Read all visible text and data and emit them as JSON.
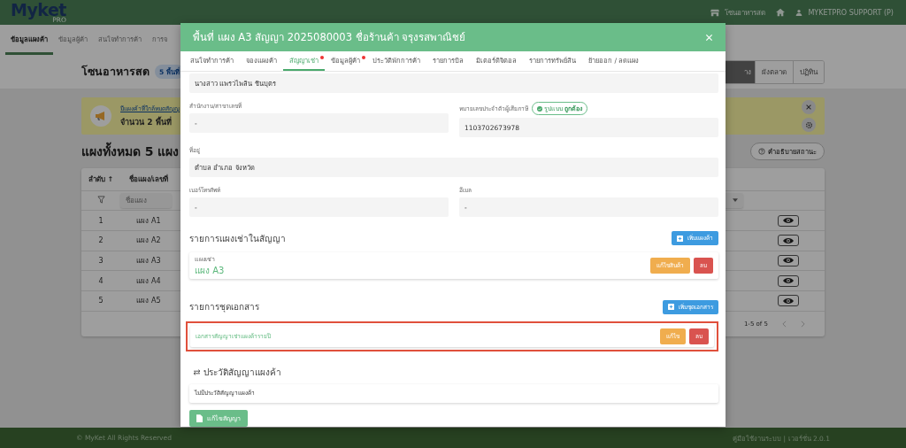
{
  "header": {
    "logo": "Myket",
    "logo_sub": "PRO",
    "zone": "โซนอาหารสด",
    "user": "MYKETPRO SUPPORT (P)"
  },
  "nav": [
    {
      "label": "ข้อมูลแผงค้า",
      "selected": true
    },
    {
      "label": "ข้อมูลผู้ค้า",
      "selected": false
    },
    {
      "label": "สนใจทำการค้า",
      "selected": false
    },
    {
      "label": "การจ",
      "selected": false
    }
  ],
  "page": {
    "title": "โซนอาหารสด",
    "badge": "5 พื้นที่",
    "views": [
      {
        "label": "าง",
        "selected": true
      },
      {
        "label": "ผังตลาด",
        "selected": false
      },
      {
        "label": "ปฏิทิน",
        "selected": false
      }
    ]
  },
  "alert": {
    "title": "มีแผงค้าที่ใกล้หมดสัญญ",
    "text": "จำนวน 2 พื้นที่"
  },
  "stalls": {
    "heading": "แผงทั้งหมด 5 แผง",
    "legend_button": "คำอธิบายสถานะ",
    "columns": [
      "ลำดับ ↑",
      "ชื่อแผง/เลขที่"
    ],
    "filter_placeholder": "ชื่อแผง",
    "rows": [
      {
        "index": "1",
        "name": "แผง A1"
      },
      {
        "index": "2",
        "name": "แผง A2"
      },
      {
        "index": "3",
        "name": "แผง A3"
      },
      {
        "index": "4",
        "name": "แผง A4"
      },
      {
        "index": "5",
        "name": "แผง A5"
      }
    ],
    "pagination": "1-5 of 5"
  },
  "footer": {
    "copyright": "© MyKet All Rights Reserved",
    "links": "คู่มือใช้งานระบบ | เวอร์ชั่น 2.0.1"
  },
  "modal": {
    "title": "พื้นที่ แผง A3 สัญญา 2025080003 ชื่อร้านค้า จรุงรสพาณิชย์",
    "tabs": [
      {
        "label": "สนใจทำการค้า",
        "selected": false,
        "notice": false
      },
      {
        "label": "จองแผงค้า",
        "selected": false,
        "notice": false
      },
      {
        "label": "สัญญาเช่า",
        "selected": true,
        "notice": true
      },
      {
        "label": "ข้อมูลผู้ค้า",
        "selected": false,
        "notice": true
      },
      {
        "label": "ประวัติพักการค้า",
        "selected": false,
        "notice": false
      },
      {
        "label": "รายการบิล",
        "selected": false,
        "notice": false
      },
      {
        "label": "มิเตอร์ดิจิตอล",
        "selected": false,
        "notice": false
      },
      {
        "label": "รายการทรัพย์สิน",
        "selected": false,
        "notice": false
      },
      {
        "label": "ย้ายออก / ลดแผง",
        "selected": false,
        "notice": false
      }
    ],
    "field_rows": [
      [
        {
          "value": "นางสาว แพรวไพลิน ชินบุตร"
        }
      ],
      [
        {
          "label": "สำนักงาน/สาขาเลขที่",
          "value": "-"
        },
        {
          "label": "หมายเลขประจำตัวผู้เสียภาษี",
          "badge": "รูปแบบ **ถูกต้อง**",
          "value": "1103702673978"
        }
      ],
      [
        {
          "label": "ที่อยู่",
          "value": "ตำบล อำเภอ จังหวัด"
        }
      ],
      [
        {
          "label": "เบอร์โทรศัพท์",
          "value": "-"
        },
        {
          "label": "อีเมล",
          "value": "-"
        }
      ]
    ],
    "stalls_section": {
      "title": "รายการแผงเช่าในสัญญา",
      "add_button": "เพิ่มแผงค้า",
      "items": [
        {
          "label": "แผงเช่า",
          "name": "แผง A3",
          "edit_button": "แก้ไขสินค้า",
          "delete_button": "ลบ"
        }
      ]
    },
    "documents_section": {
      "title": "รายการชุดเอกสาร",
      "add_button": "เพิ่มชุดเอกสาร",
      "items": [
        {
          "name": "เอกสารสัญญาเช่าแผงค้ารายปี",
          "highlighted": true,
          "edit_button": "แก้ไข",
          "delete_button": "ลบ"
        }
      ]
    },
    "history": {
      "title": "ประวัติสัญญาแผงค้า",
      "empty_text": "ไม่มีประวัติสัญญาแผงค้า"
    },
    "edit_contract_button": "แก้ไขสัญญา"
  }
}
